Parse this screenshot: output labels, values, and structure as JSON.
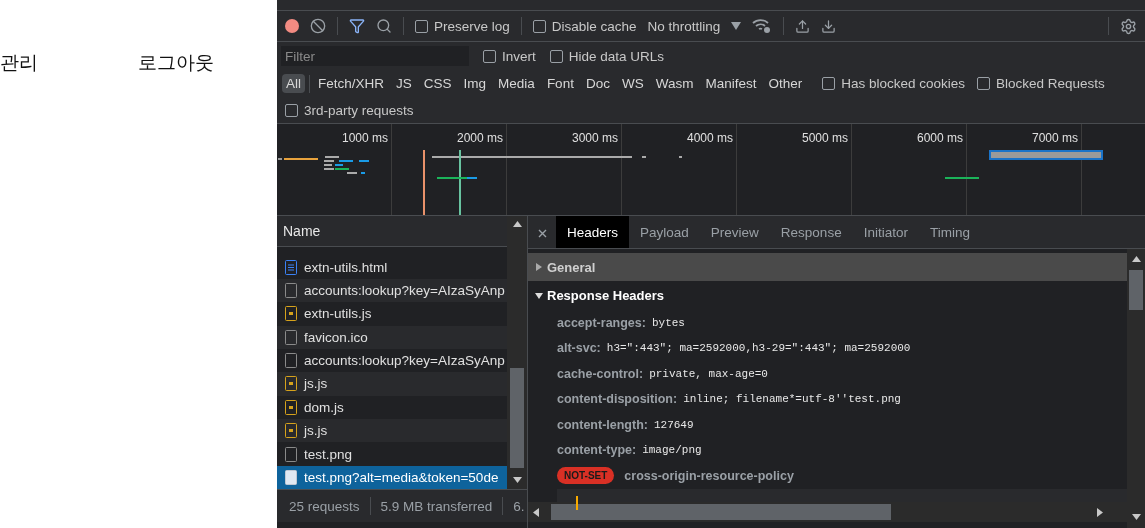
{
  "page": {
    "nav_links": [
      "관리",
      "로그아웃"
    ]
  },
  "devtools": {
    "toolbar": {
      "recording": true,
      "preserve_log": {
        "label": "Preserve log",
        "checked": false
      },
      "disable_cache": {
        "label": "Disable cache",
        "checked": false
      },
      "throttling": "No throttling"
    },
    "filter_bar": {
      "placeholder": "Filter",
      "invert": {
        "label": "Invert",
        "checked": false
      },
      "hide_data_urls": {
        "label": "Hide data URLs",
        "checked": false
      }
    },
    "type_filters": [
      {
        "label": "All",
        "selected": true
      },
      {
        "label": "Fetch/XHR",
        "selected": false
      },
      {
        "label": "JS",
        "selected": false
      },
      {
        "label": "CSS",
        "selected": false
      },
      {
        "label": "Img",
        "selected": false
      },
      {
        "label": "Media",
        "selected": false
      },
      {
        "label": "Font",
        "selected": false
      },
      {
        "label": "Doc",
        "selected": false
      },
      {
        "label": "WS",
        "selected": false
      },
      {
        "label": "Wasm",
        "selected": false
      },
      {
        "label": "Manifest",
        "selected": false
      },
      {
        "label": "Other",
        "selected": false
      }
    ],
    "has_blocked_cookies": {
      "label": "Has blocked cookies",
      "checked": false
    },
    "blocked_requests": {
      "label": "Blocked Requests",
      "checked": false
    },
    "third_party_requests": {
      "label": "3rd-party requests",
      "checked": false
    },
    "timeline": {
      "ticks": [
        "1000 ms",
        "2000 ms",
        "3000 ms",
        "4000 ms",
        "5000 ms",
        "6000 ms",
        "7000 ms"
      ]
    },
    "requests": {
      "column": "Name",
      "rows": [
        {
          "name": "extn-utils.html",
          "kind": "document",
          "selected": false
        },
        {
          "name": "accounts:lookup?key=AIzaSyAnp",
          "kind": "other",
          "selected": false
        },
        {
          "name": "extn-utils.js",
          "kind": "script",
          "selected": false
        },
        {
          "name": "favicon.ico",
          "kind": "other",
          "selected": false
        },
        {
          "name": "accounts:lookup?key=AIzaSyAnp",
          "kind": "other",
          "selected": false
        },
        {
          "name": "js.js",
          "kind": "script",
          "selected": false
        },
        {
          "name": "dom.js",
          "kind": "script",
          "selected": false
        },
        {
          "name": "js.js",
          "kind": "script",
          "selected": false
        },
        {
          "name": "test.png",
          "kind": "other",
          "selected": false
        },
        {
          "name": "test.png?alt=media&token=50de",
          "kind": "image",
          "selected": true
        }
      ],
      "status": [
        "25 requests",
        "5.9 MB transferred",
        "6."
      ]
    },
    "details": {
      "tabs": [
        {
          "label": "Headers",
          "selected": true
        },
        {
          "label": "Payload",
          "selected": false
        },
        {
          "label": "Preview",
          "selected": false
        },
        {
          "label": "Response",
          "selected": false
        },
        {
          "label": "Initiator",
          "selected": false
        },
        {
          "label": "Timing",
          "selected": false
        }
      ],
      "sections": [
        {
          "title": "General",
          "expanded": false
        },
        {
          "title": "Response Headers",
          "expanded": true
        }
      ],
      "headers": [
        {
          "name": "accept-ranges:",
          "value": "bytes"
        },
        {
          "name": "alt-svc:",
          "value": "h3=\":443\"; ma=2592000,h3-29=\":443\"; ma=2592000"
        },
        {
          "name": "cache-control:",
          "value": "private, max-age=0"
        },
        {
          "name": "content-disposition:",
          "value": "inline; filename*=utf-8''test.png"
        },
        {
          "name": "content-length:",
          "value": "127649"
        },
        {
          "name": "content-type:",
          "value": "image/png"
        }
      ],
      "issue": {
        "badge": "NOT-SET",
        "name": "cross-origin-resource-policy"
      }
    }
  }
}
